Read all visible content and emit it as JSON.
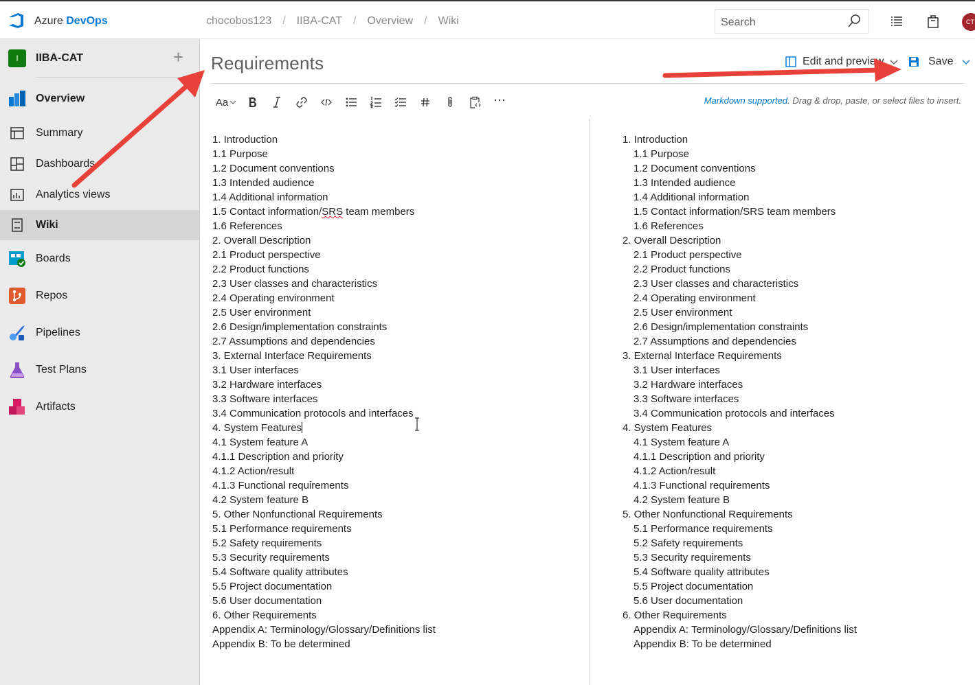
{
  "header": {
    "brand_prefix": "Azure ",
    "brand_name": "DevOps",
    "breadcrumbs": [
      "chocobos123",
      "IIBA-CAT",
      "Overview",
      "Wiki"
    ],
    "search_placeholder": "Search",
    "avatar_initials": "CT"
  },
  "sidebar": {
    "project_initial": "I",
    "project_name": "IIBA-CAT",
    "add_symbol": "+",
    "items": [
      {
        "label": "Overview",
        "icon": "overview-icon"
      },
      {
        "label": "Summary",
        "icon": "summary-icon"
      },
      {
        "label": "Dashboards",
        "icon": "dashboards-icon"
      },
      {
        "label": "Analytics views",
        "icon": "analytics-icon"
      },
      {
        "label": "Wiki",
        "icon": "wiki-icon"
      },
      {
        "label": "Boards",
        "icon": "boards-icon"
      },
      {
        "label": "Repos",
        "icon": "repos-icon"
      },
      {
        "label": "Pipelines",
        "icon": "pipelines-icon"
      },
      {
        "label": "Test Plans",
        "icon": "test-plans-icon"
      },
      {
        "label": "Artifacts",
        "icon": "artifacts-icon"
      }
    ]
  },
  "page": {
    "title": "Requirements",
    "edit_preview_label": "Edit and preview",
    "save_label": "Save",
    "toolbar_font_label": "Aa",
    "hint_link": "Markdown supported.",
    "hint_text": " Drag & drop, paste, or select files to insert."
  },
  "content": {
    "lines": [
      "1. Introduction",
      "1.1 Purpose",
      "1.2 Document conventions",
      "1.3 Intended audience",
      "1.4 Additional information",
      "1.5 Contact information/SRS team members",
      "1.6 References",
      "2. Overall Description",
      "2.1 Product perspective",
      "2.2 Product functions",
      "2.3 User classes and characteristics",
      "2.4 Operating environment",
      "2.5 User environment",
      "2.6 Design/implementation constraints",
      "2.7 Assumptions and dependencies",
      "3. External Interface Requirements",
      "3.1 User interfaces",
      "3.2 Hardware interfaces",
      "3.3 Software interfaces",
      "3.4 Communication protocols and interfaces",
      "4. System Features",
      "4.1 System feature A",
      "4.1.1 Description and priority",
      "4.1.2 Action/result",
      "4.1.3 Functional requirements",
      "4.2 System feature B",
      "5. Other Nonfunctional Requirements",
      "5.1 Performance requirements",
      "5.2 Safety requirements",
      "5.3 Security requirements",
      "5.4 Software quality attributes",
      "5.5 Project documentation",
      "5.6 User documentation",
      "6. Other Requirements",
      "Appendix A: Terminology/Glossary/Definitions list",
      "Appendix B: To be determined"
    ],
    "preview_indent": [
      false,
      true,
      true,
      true,
      true,
      true,
      true,
      false,
      true,
      true,
      true,
      true,
      true,
      true,
      true,
      false,
      true,
      true,
      true,
      true,
      false,
      true,
      true,
      true,
      true,
      true,
      false,
      true,
      true,
      true,
      true,
      true,
      true,
      false,
      true,
      true
    ]
  },
  "colors": {
    "accent": "#0078d4",
    "annotation_arrow": "#e8413a",
    "sidebar_bg": "#eaeaea",
    "selected_bg": "#d6d6d6"
  }
}
